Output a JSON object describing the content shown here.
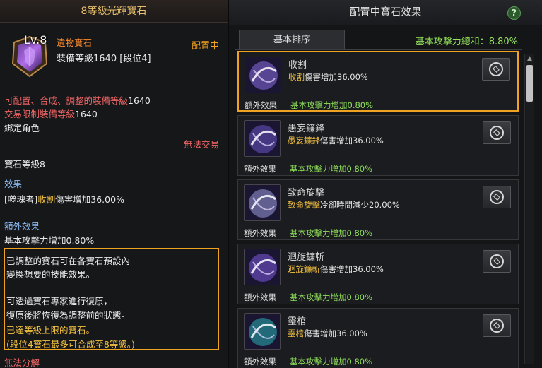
{
  "tooltip": {
    "title": "8等級光輝寶石",
    "level_badge": "Lv.8",
    "gem_type": "遺物寶石",
    "equip_level": "裝備等級1640 [段位4]",
    "equipped_status": "配置中",
    "lines": {
      "config_req_prefix": "可配置、合成、調整的裝備等級",
      "config_req_value": "1640",
      "trade_limit_prefix": "交易限制裝備等級",
      "trade_limit_value": "1640",
      "bound": "綁定角色",
      "no_trade": "無法交易",
      "gem_level": "寶石等級8",
      "effect_header": "效果",
      "effect_prefix": "[噬魂者]",
      "effect_skill": "收割",
      "effect_suffix": "傷害增加36.00%",
      "extra_header": "額外效果",
      "extra_value": "基本攻擊力增加0.80%",
      "no_disassemble": "無法分解"
    },
    "notice": {
      "line1": "已調整的寶石可在各寶石預設內",
      "line2": "變換想要的技能效果。",
      "line3": "可透過寶石專家進行復原，",
      "line4": "復原後將恢復為調整前的狀態。",
      "line5": "已達等級上限的寶石。",
      "line6": "(段位4寶石最多可合成至8等級。)"
    }
  },
  "panel": {
    "title": "配置中寶石效果",
    "help_label": "?",
    "tab_label": "基本排序",
    "total_label": "基本攻擊力總和：8.80%",
    "extra_label": "額外效果",
    "gems": [
      {
        "skill": "收割",
        "highlight": "收割",
        "effect": "傷害增加36.00%",
        "extra": "基本攻擊力增加0.80%",
        "icon": "reaper-swirl-icon",
        "color": "#8a6ee8"
      },
      {
        "skill": "愚妄鐮鋒",
        "highlight": "愚妄鐮鋒",
        "effect": "傷害增加36.00%",
        "extra": "基本攻擊力增加0.80%",
        "icon": "scythe-icon",
        "color": "#6b54c8"
      },
      {
        "skill": "致命旋擊",
        "highlight": "致命旋擊",
        "effect": "冷卻時間減少20.00%",
        "extra": "基本攻擊力增加0.80%",
        "icon": "vortex-icon",
        "color": "#9a9ce0"
      },
      {
        "skill": "迴旋鐮斬",
        "highlight": "迴旋鐮斬",
        "effect": "傷害增加36.00%",
        "extra": "基本攻擊力增加0.80%",
        "icon": "spin-slash-icon",
        "color": "#7b5ae0"
      },
      {
        "skill": "靈棺",
        "highlight": "靈棺",
        "effect": "傷害增加36.00%",
        "extra": "基本攻擊力增加0.80%",
        "icon": "spirit-coffin-icon",
        "color": "#2ab0b8"
      }
    ]
  }
}
